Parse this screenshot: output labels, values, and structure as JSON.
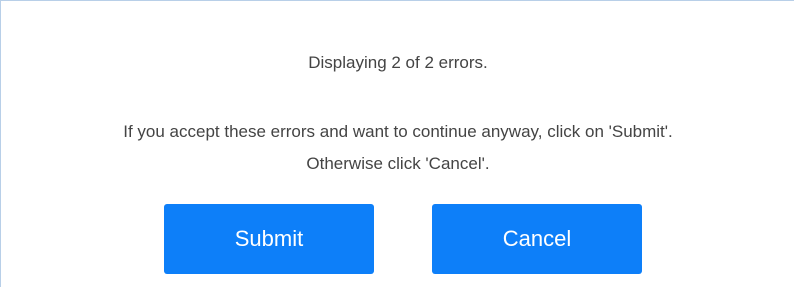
{
  "dialog": {
    "summary": "Displaying 2 of 2 errors.",
    "message_line1": "If you accept these errors and want to continue anyway, click on 'Submit'.",
    "message_line2": "Otherwise click 'Cancel'.",
    "submit_label": "Submit",
    "cancel_label": "Cancel"
  },
  "colors": {
    "button_background": "#0d7ff9",
    "button_text": "#ffffff",
    "body_text": "#444444",
    "border": "#b8cfe8"
  }
}
